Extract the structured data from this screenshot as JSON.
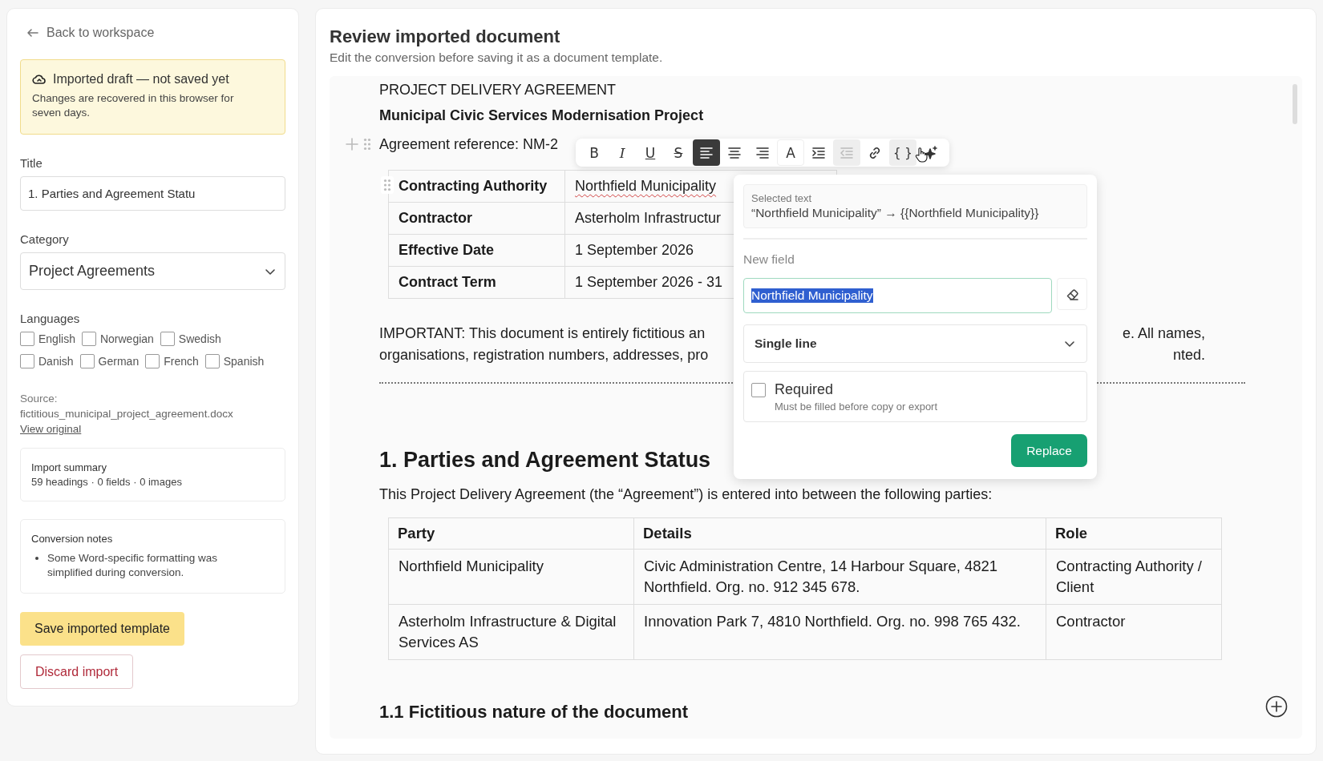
{
  "sidebar": {
    "back_link": "Back to workspace",
    "notice": {
      "title": "Imported draft — not saved yet",
      "text": "Changes are recovered in this browser for seven days."
    },
    "title_field": {
      "label": "Title",
      "value": "1. Parties and Agreement Statu"
    },
    "category": {
      "label": "Category",
      "value": "Project Agreements"
    },
    "languages": {
      "label": "Languages",
      "options": [
        {
          "label": "English",
          "checked": false
        },
        {
          "label": "Norwegian",
          "checked": false
        },
        {
          "label": "Swedish",
          "checked": false
        },
        {
          "label": "Danish",
          "checked": false
        },
        {
          "label": "German",
          "checked": false
        },
        {
          "label": "French",
          "checked": false
        },
        {
          "label": "Spanish",
          "checked": false
        }
      ]
    },
    "source": {
      "label": "Source:",
      "file": "fictitious_municipal_project_agreement.docx",
      "link": "View original"
    },
    "import_summary": {
      "title": "Import summary",
      "text": "59 headings · 0 fields · 0 images"
    },
    "conversion_notes": {
      "title": "Conversion notes",
      "items": [
        "Some Word-specific formatting was simplified during conversion."
      ]
    },
    "buttons": [
      {
        "label": "Save imported template",
        "kind": "primary"
      },
      {
        "label": "Discard import",
        "kind": "danger"
      }
    ]
  },
  "main": {
    "title": "Review imported document",
    "subtitle": "Edit the conversion before saving it as a document template.",
    "document": [
      {
        "kind": "plain",
        "text": "PROJECT DELIVERY AGREEMENT"
      },
      {
        "kind": "bold",
        "text": "Municipal Civic Services Modernisation Project"
      },
      {
        "kind": "reference",
        "text": "Agreement reference: NM-2"
      },
      {
        "kind": "kv_table",
        "rows": [
          {
            "key": "Contracting Authority",
            "value": "Northfield Municipality",
            "spellcheck": true
          },
          {
            "key": "Contractor",
            "value": "Asterholm Infrastructur",
            "spellcheck": false
          },
          {
            "key": "Effective Date",
            "value": "1 September 2026",
            "spellcheck": false
          },
          {
            "key": "Contract Term",
            "value": "1 September 2026 - 31",
            "spellcheck": false
          }
        ]
      },
      {
        "kind": "split_paragraph",
        "lines": [
          {
            "left": "IMPORTANT: This document is entirely fictitious an",
            "right": "e. All names,"
          },
          {
            "left": "organisations, registration numbers, addresses, pro",
            "right": "nted."
          }
        ]
      },
      {
        "kind": "rule"
      },
      {
        "kind": "h1",
        "text": "1. Parties and Agreement Status"
      },
      {
        "kind": "paragraph",
        "text": "This Project Delivery Agreement (the “Agreement”) is entered into between the following parties:"
      },
      {
        "kind": "table",
        "columns": [
          "Party",
          "Details",
          "Role"
        ],
        "rows": [
          [
            "Northfield Municipality",
            "Civic Administration Centre, 14 Harbour Square, 4821 Northfield. Org. no. 912 345 678.",
            "Contracting Authority / Client"
          ],
          [
            "Asterholm Infrastructure & Digital Services AS",
            "Innovation Park 7, 4810 Northfield. Org. no. 998 765 432.",
            "Contractor"
          ]
        ]
      },
      {
        "kind": "h2",
        "text": "1.1 Fictitious nature of the document"
      }
    ]
  },
  "toolbar": {
    "tools": [
      {
        "kind": "bold",
        "label": "B",
        "selected": false,
        "disabled": false,
        "hovered": false
      },
      {
        "kind": "italic",
        "label": "I",
        "selected": false,
        "disabled": false,
        "hovered": false
      },
      {
        "kind": "underline",
        "label": "U",
        "selected": false,
        "disabled": false,
        "hovered": false
      },
      {
        "kind": "strike",
        "label": "S",
        "selected": false,
        "disabled": false,
        "hovered": false
      },
      {
        "kind": "align_left",
        "selected": true,
        "disabled": false,
        "hovered": false
      },
      {
        "kind": "align_center",
        "selected": false,
        "disabled": false,
        "hovered": false
      },
      {
        "kind": "align_right",
        "selected": false,
        "disabled": false,
        "hovered": false
      },
      {
        "kind": "text_color",
        "label": "A",
        "selected": false,
        "disabled": false,
        "hovered": false
      },
      {
        "kind": "indent",
        "selected": false,
        "disabled": false,
        "hovered": false
      },
      {
        "kind": "outdent",
        "selected": false,
        "disabled": true,
        "hovered": false
      },
      {
        "kind": "link",
        "selected": false,
        "disabled": false,
        "hovered": false
      },
      {
        "kind": "field",
        "label": "{ }",
        "selected": false,
        "disabled": false,
        "hovered": true
      },
      {
        "kind": "ai",
        "selected": false,
        "disabled": false,
        "hovered": false
      }
    ]
  },
  "field_popover": {
    "selected_label": "Selected text",
    "selected_text": "“Northfield Municipality” → {{Northfield Municipality}}",
    "new_field_label": "New field",
    "field_value": "Northfield Municipality",
    "value_selected": true,
    "type": "Single line",
    "required": {
      "label": "Required",
      "hint": "Must be filled before copy or export",
      "checked": false
    },
    "button": "Replace"
  }
}
